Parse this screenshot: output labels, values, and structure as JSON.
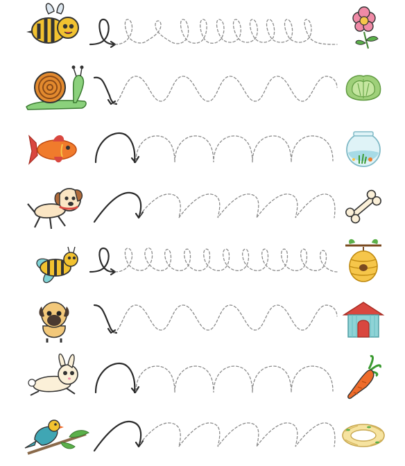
{
  "page": {
    "kind": "tracing-lines-worksheet",
    "text": ""
  },
  "rows": [
    {
      "animal": "bee",
      "target": "flower",
      "pattern": "loop"
    },
    {
      "animal": "snail",
      "target": "lettuce",
      "pattern": "wave"
    },
    {
      "animal": "goldfish",
      "target": "fishbowl",
      "pattern": "arch"
    },
    {
      "animal": "puppy",
      "target": "bone",
      "pattern": "slant-arch"
    },
    {
      "animal": "bee",
      "target": "beehive",
      "pattern": "loop"
    },
    {
      "animal": "pug",
      "target": "dog-house",
      "pattern": "wave"
    },
    {
      "animal": "bunny",
      "target": "carrot",
      "pattern": "arch"
    },
    {
      "animal": "bird",
      "target": "nest",
      "pattern": "slant-arch"
    }
  ],
  "colors": {
    "stroke": "#2b2b2b",
    "dashed": "#8a8a8a",
    "bee_yellow": "#f2c230",
    "snail_green": "#8bd17c",
    "fish_orange": "#f07b2c",
    "dog_brown": "#b06a3a",
    "leaf_green": "#5bb04a",
    "house_red": "#d9473f",
    "house_teal": "#8fd3d6",
    "carrot_orange": "#ee6b2a",
    "flower_pink": "#f08aa6"
  }
}
